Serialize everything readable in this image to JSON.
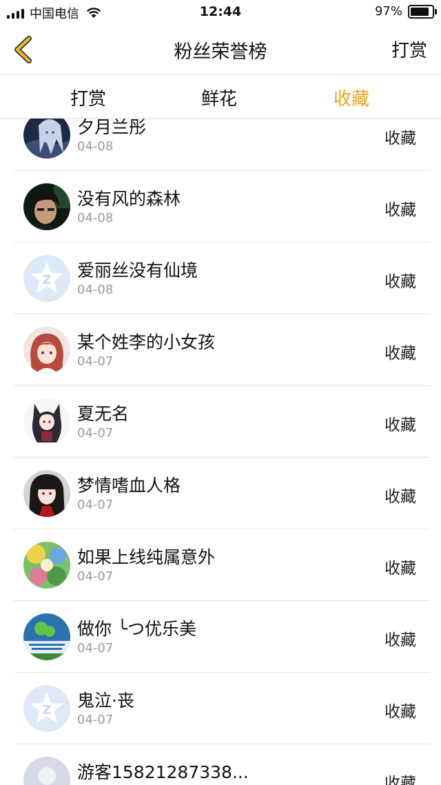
{
  "status": {
    "carrier": "中国电信",
    "time": "12:44",
    "battery": "97%"
  },
  "nav": {
    "title": "粉丝荣誉榜",
    "right": "打赏"
  },
  "tabs": [
    {
      "label": "打赏"
    },
    {
      "label": "鲜花"
    },
    {
      "label": "收藏"
    }
  ],
  "colors": {
    "accent": "#e8a420"
  },
  "fans": [
    {
      "name": "夕月兰彤",
      "date": "04-08",
      "action": "收藏",
      "avatar": "anime-girl-white-hair"
    },
    {
      "name": "没有风的森林",
      "date": "04-08",
      "action": "收藏",
      "avatar": "boy-dark-photo"
    },
    {
      "name": "爱丽丝没有仙境",
      "date": "04-08",
      "action": "收藏",
      "avatar": "default-star-icon"
    },
    {
      "name": "某个姓李的小女孩",
      "date": "04-07",
      "action": "收藏",
      "avatar": "anime-girl-red-hair"
    },
    {
      "name": "夏无名",
      "date": "04-07",
      "action": "收藏",
      "avatar": "anime-catgirl"
    },
    {
      "name": "梦情嗜血人格",
      "date": "04-07",
      "action": "收藏",
      "avatar": "girl-dark-hair"
    },
    {
      "name": "如果上线纯属意外",
      "date": "04-07",
      "action": "收藏",
      "avatar": "colorful-anime"
    },
    {
      "name": "做你 ╰つ优乐美",
      "date": "04-07",
      "action": "收藏",
      "avatar": "wechat-poster"
    },
    {
      "name": "鬼泣·丧",
      "date": "04-07",
      "action": "收藏",
      "avatar": "default-star-icon"
    },
    {
      "name": "游客15821287338...",
      "date": "",
      "action": "收藏",
      "avatar": "default-user-icon"
    }
  ]
}
